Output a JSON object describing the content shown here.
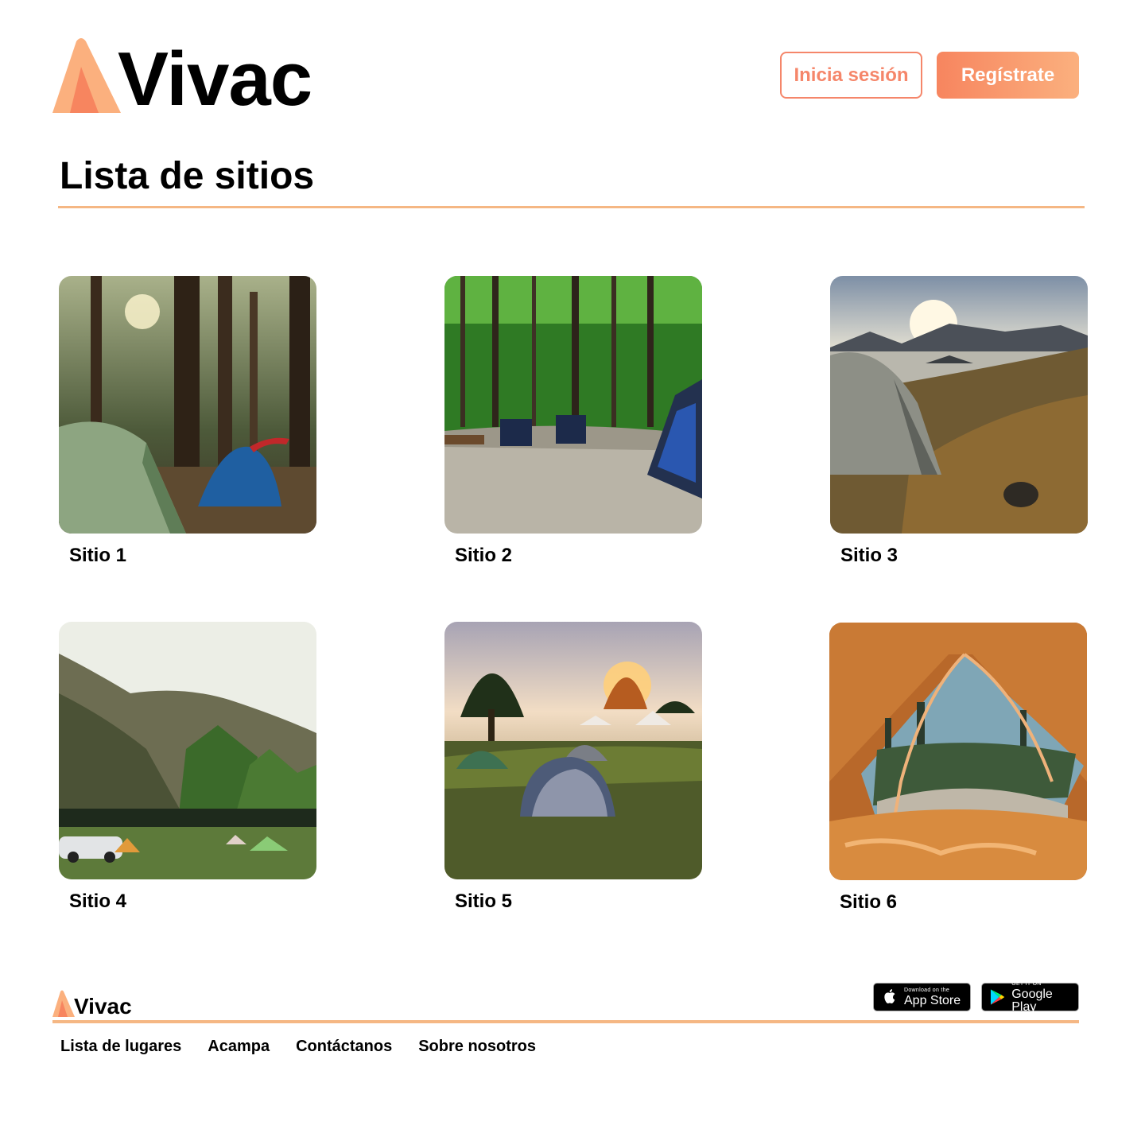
{
  "brand": {
    "name": "Vivac",
    "accent": "#f7855f",
    "accent_light": "#fbb07e",
    "rule_color": "#f5b784"
  },
  "header": {
    "login_label": "Inicia sesión",
    "register_label": "Regístrate"
  },
  "main": {
    "title": "Lista de sitios",
    "sites": [
      {
        "label": "Sitio 1",
        "scene": "forest-tents"
      },
      {
        "label": "Sitio 2",
        "scene": "campsite-chairs"
      },
      {
        "label": "Sitio 3",
        "scene": "lake-tent-sunset"
      },
      {
        "label": "Sitio 4",
        "scene": "mountain-meadow-camp"
      },
      {
        "label": "Sitio 5",
        "scene": "field-tents-sunset"
      },
      {
        "label": "Sitio 6",
        "scene": "tent-view-forest"
      }
    ]
  },
  "footer": {
    "brand": "Vivac",
    "app_store": {
      "small": "Download on the",
      "big": "App Store"
    },
    "google_play": {
      "small": "GET IT ON",
      "big": "Google Play"
    },
    "links": [
      "Lista de lugares",
      "Acampa",
      "Contáctanos",
      "Sobre nosotros"
    ]
  }
}
